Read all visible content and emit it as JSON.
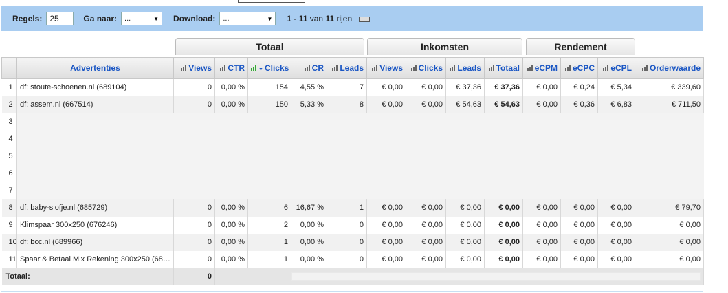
{
  "toolbar": {
    "rows_label": "Regels:",
    "rows_value": "25",
    "goto_label": "Ga naar:",
    "goto_value": "...",
    "download_label": "Download:",
    "download_value": "...",
    "range_a": "1",
    "range_sep": " - ",
    "range_b": "11",
    "range_of": " van ",
    "range_total": "11",
    "range_suffix": " rijen"
  },
  "groups": {
    "totaal": "Totaal",
    "inkomsten": "Inkomsten",
    "rendement": "Rendement"
  },
  "columns": {
    "ads": "Advertenties",
    "views": "Views",
    "ctr": "CTR",
    "clicks": "Clicks",
    "cr": "CR",
    "leads": "Leads",
    "ink_views": "Views",
    "ink_clicks": "Clicks",
    "ink_leads": "Leads",
    "ink_totaal": "Totaal",
    "ecpm": "eCPM",
    "ecpc": "eCPC",
    "ecpl": "eCPL",
    "orderwaarde": "Orderwaarde"
  },
  "rows": [
    {
      "i": "1",
      "name": "df: stoute-schoenen.nl (689104)",
      "views": "0",
      "ctr": "0,00 %",
      "clicks": "154",
      "cr": "4,55 %",
      "leads": "7",
      "iv": "€ 0,00",
      "ic": "€ 0,00",
      "il": "€ 37,36",
      "it": "€ 37,36",
      "ecpm": "€ 0,00",
      "ecpc": "€ 0,24",
      "ecpl": "€ 5,34",
      "ow": "€ 339,60"
    },
    {
      "i": "2",
      "name": "df: assem.nl (667514)",
      "views": "0",
      "ctr": "0,00 %",
      "clicks": "150",
      "cr": "5,33 %",
      "leads": "8",
      "iv": "€ 0,00",
      "ic": "€ 0,00",
      "il": "€ 54,63",
      "it": "€ 54,63",
      "ecpm": "€ 0,00",
      "ecpc": "€ 0,36",
      "ecpl": "€ 6,83",
      "ow": "€ 711,50"
    },
    {
      "i": "3"
    },
    {
      "i": "4"
    },
    {
      "i": "5"
    },
    {
      "i": "6"
    },
    {
      "i": "7"
    },
    {
      "i": "8",
      "name": "df: baby-slofje.nl (685729)",
      "views": "0",
      "ctr": "0,00 %",
      "clicks": "6",
      "cr": "16,67 %",
      "leads": "1",
      "iv": "€ 0,00",
      "ic": "€ 0,00",
      "il": "€ 0,00",
      "it": "€ 0,00",
      "ecpm": "€ 0,00",
      "ecpc": "€ 0,00",
      "ecpl": "€ 0,00",
      "ow": "€ 79,70"
    },
    {
      "i": "9",
      "name": "Klimspaar 300x250 (676246)",
      "views": "0",
      "ctr": "0,00 %",
      "clicks": "2",
      "cr": "0,00 %",
      "leads": "0",
      "iv": "€ 0,00",
      "ic": "€ 0,00",
      "il": "€ 0,00",
      "it": "€ 0,00",
      "ecpm": "€ 0,00",
      "ecpc": "€ 0,00",
      "ecpl": "€ 0,00",
      "ow": "€ 0,00"
    },
    {
      "i": "10",
      "name": "df: bcc.nl (689966)",
      "views": "0",
      "ctr": "0,00 %",
      "clicks": "1",
      "cr": "0,00 %",
      "leads": "0",
      "iv": "€ 0,00",
      "ic": "€ 0,00",
      "il": "€ 0,00",
      "it": "€ 0,00",
      "ecpm": "€ 0,00",
      "ecpc": "€ 0,00",
      "ecpl": "€ 0,00",
      "ow": "€ 0,00"
    },
    {
      "i": "11",
      "name": "Spaar & Betaal Mix Rekening 300x250 (688...",
      "views": "0",
      "ctr": "0,00 %",
      "clicks": "1",
      "cr": "0,00 %",
      "leads": "0",
      "iv": "€ 0,00",
      "ic": "€ 0,00",
      "il": "€ 0,00",
      "it": "€ 0,00",
      "ecpm": "€ 0,00",
      "ecpc": "€ 0,00",
      "ecpl": "€ 0,00",
      "ow": "€ 0,00"
    }
  ],
  "totals": {
    "label": "Totaal:",
    "views": "0"
  },
  "icons": {
    "sort": "bar-chart-icon",
    "sorted": "sort-desc-icon",
    "print": "printer-icon",
    "dropdown": "chevron-down-icon"
  },
  "colors": {
    "toolbar_bg": "#a9cdf1",
    "header_link": "#1a56c4"
  }
}
